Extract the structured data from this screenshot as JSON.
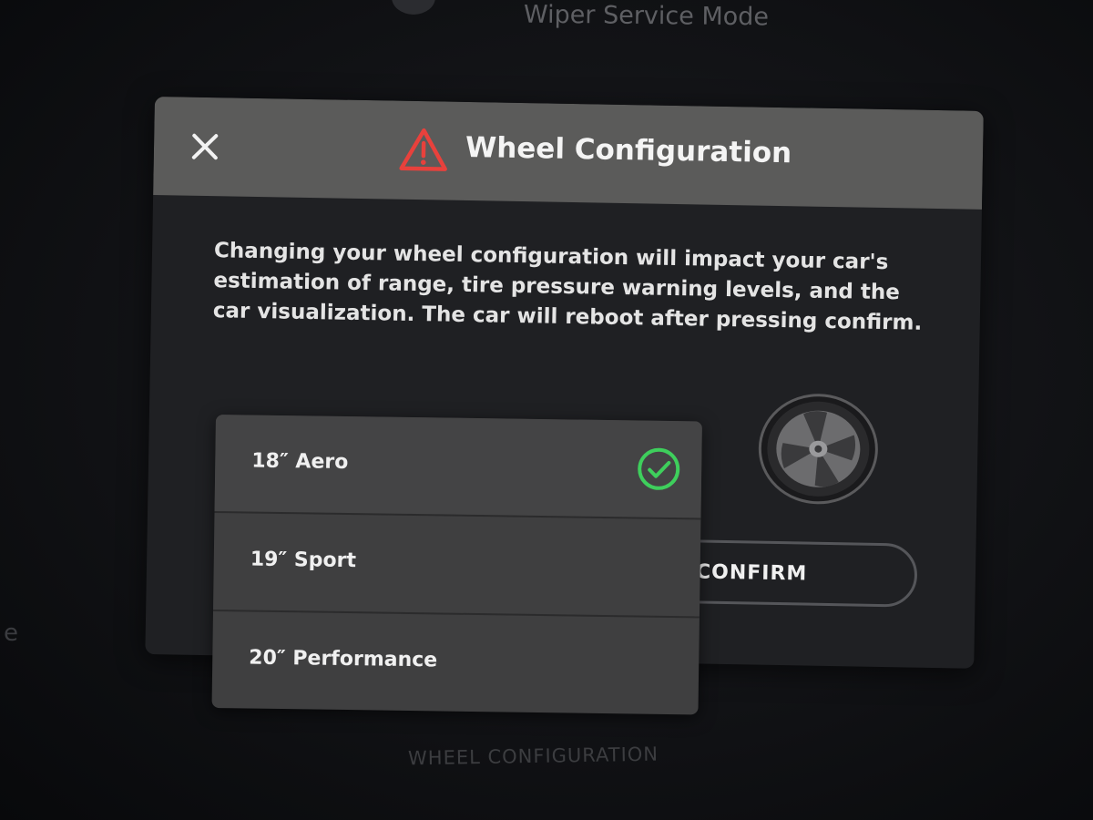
{
  "background": {
    "top_label": "Wiper Service Mode",
    "bottom_label": "WHEEL CONFIGURATION",
    "left_fragment": "e"
  },
  "modal": {
    "title": "Wheel Configuration",
    "close_icon": "close-icon",
    "warning_icon": "warning-triangle-icon",
    "warning_color": "#e8413c",
    "header_color": "#5b5b5a",
    "message": "Changing your wheel configuration will impact your car's estimation of range, tire pressure warning levels, and the car visualization. The car will reboot after pressing confirm.",
    "confirm_label": "CONFIRM"
  },
  "wheel_options": {
    "selected": "18\" Aero",
    "check_color": "#3ecf5c",
    "items": [
      {
        "label": "18″ Aero",
        "selected": true
      },
      {
        "label": "19″ Sport",
        "selected": false
      },
      {
        "label": "20″ Performance",
        "selected": false
      }
    ]
  }
}
